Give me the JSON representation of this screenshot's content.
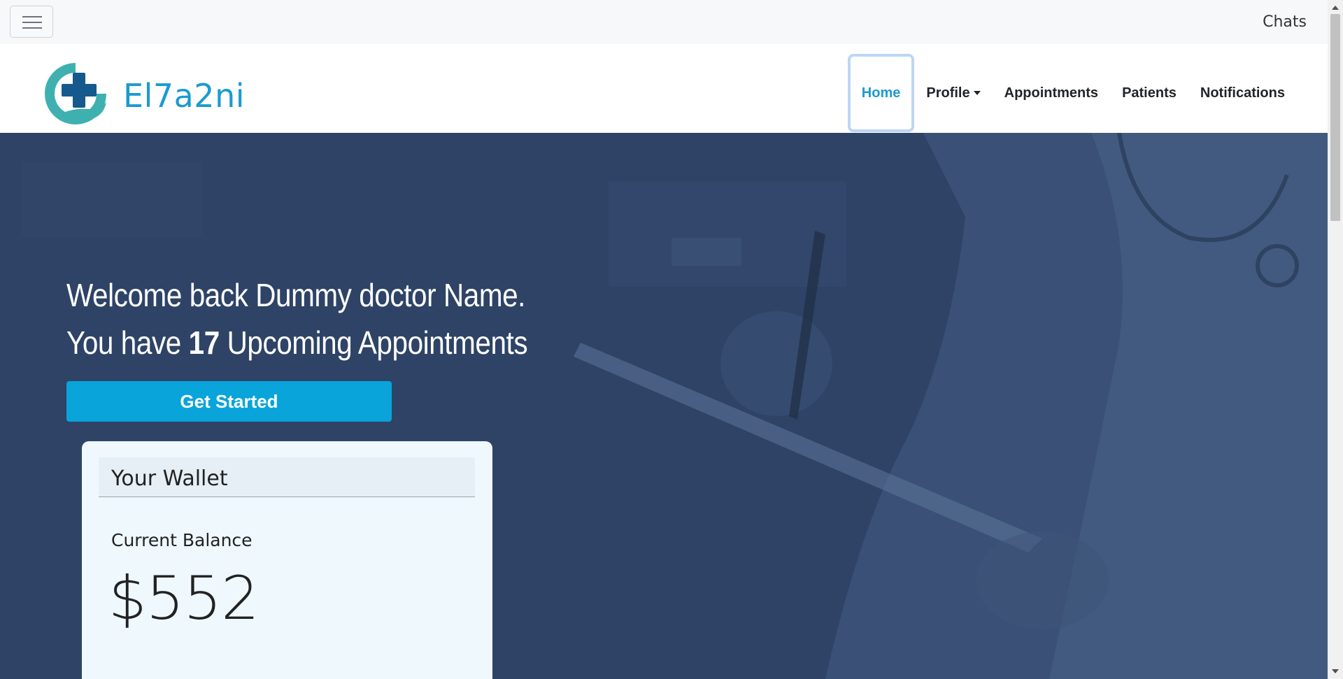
{
  "topbar": {
    "menu_icon": "hamburger-menu-icon",
    "chats_label": "Chats"
  },
  "brand": {
    "logo_icon": "medical-cross-hand-logo",
    "name": "El7a2ni",
    "color": "#1a9bd1"
  },
  "nav": {
    "items": [
      {
        "label": "Home",
        "active": true
      },
      {
        "label": "Profile",
        "dropdown": true
      },
      {
        "label": "Appointments"
      },
      {
        "label": "Patients"
      },
      {
        "label": "Notifications"
      }
    ]
  },
  "hero": {
    "welcome_line": "Welcome back Dummy doctor Name.",
    "appointments_prefix": "You have ",
    "appointments_count": "17",
    "appointments_suffix": " Upcoming Appointments",
    "cta_label": "Get Started",
    "cta_color": "#08a4da",
    "overlay_color": "#2e4366"
  },
  "wallet": {
    "title": "Your Wallet",
    "balance_label": "Current Balance",
    "balance_value": "$552"
  }
}
